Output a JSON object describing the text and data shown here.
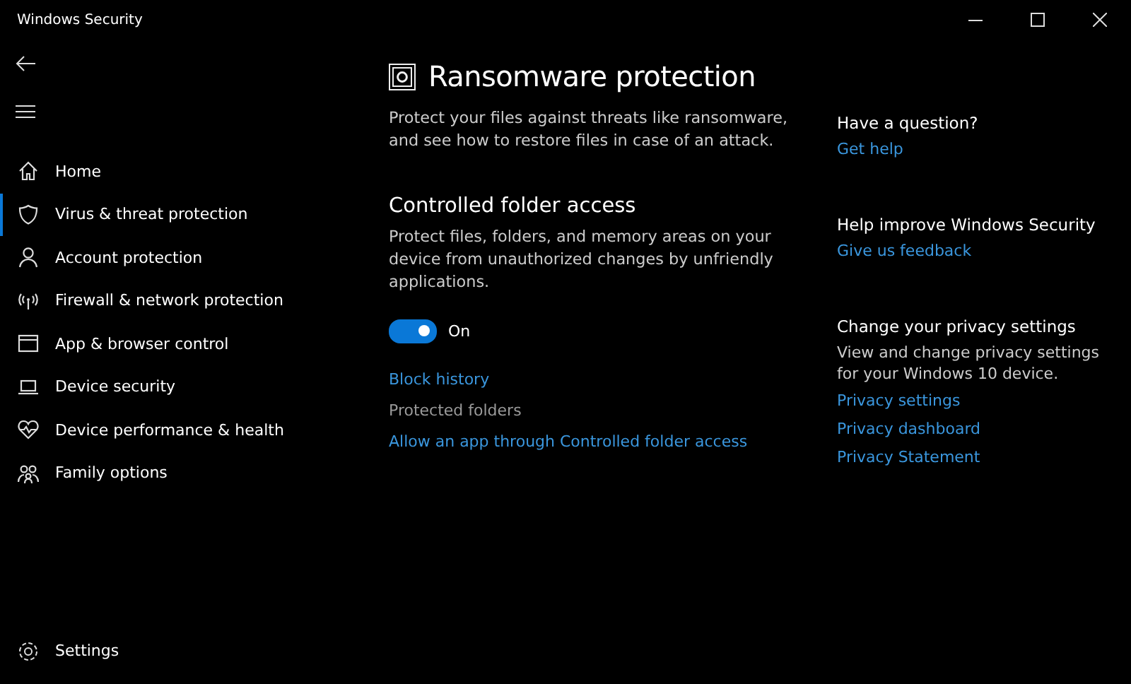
{
  "window": {
    "title": "Windows Security"
  },
  "sidebar": {
    "items": [
      {
        "label": "Home",
        "selected": false
      },
      {
        "label": "Virus & threat protection",
        "selected": true
      },
      {
        "label": "Account protection",
        "selected": false
      },
      {
        "label": "Firewall & network protection",
        "selected": false
      },
      {
        "label": "App & browser control",
        "selected": false
      },
      {
        "label": "Device security",
        "selected": false
      },
      {
        "label": "Device performance & health",
        "selected": false
      },
      {
        "label": "Family options",
        "selected": false
      }
    ],
    "settings": "Settings"
  },
  "page": {
    "title": "Ransomware protection",
    "description": "Protect your files against threats like ransomware, and see how to restore files in case of an attack.",
    "section": {
      "title": "Controlled folder access",
      "description": "Protect files, folders, and memory areas on your device from unauthorized changes by unfriendly applications.",
      "toggle": {
        "on": true,
        "label": "On"
      },
      "links": [
        {
          "label": "Block history",
          "hovered": false
        },
        {
          "label": "Protected folders",
          "hovered": true
        },
        {
          "label": "Allow an app through Controlled folder access",
          "hovered": false
        }
      ]
    }
  },
  "aside": [
    {
      "title": "Have a question?",
      "links": [
        "Get help"
      ]
    },
    {
      "title": "Help improve Windows Security",
      "links": [
        "Give us feedback"
      ]
    },
    {
      "title": "Change your privacy settings",
      "text": "View and change privacy settings for your Windows 10 device.",
      "links": [
        "Privacy settings",
        "Privacy dashboard",
        "Privacy Statement"
      ]
    }
  ]
}
